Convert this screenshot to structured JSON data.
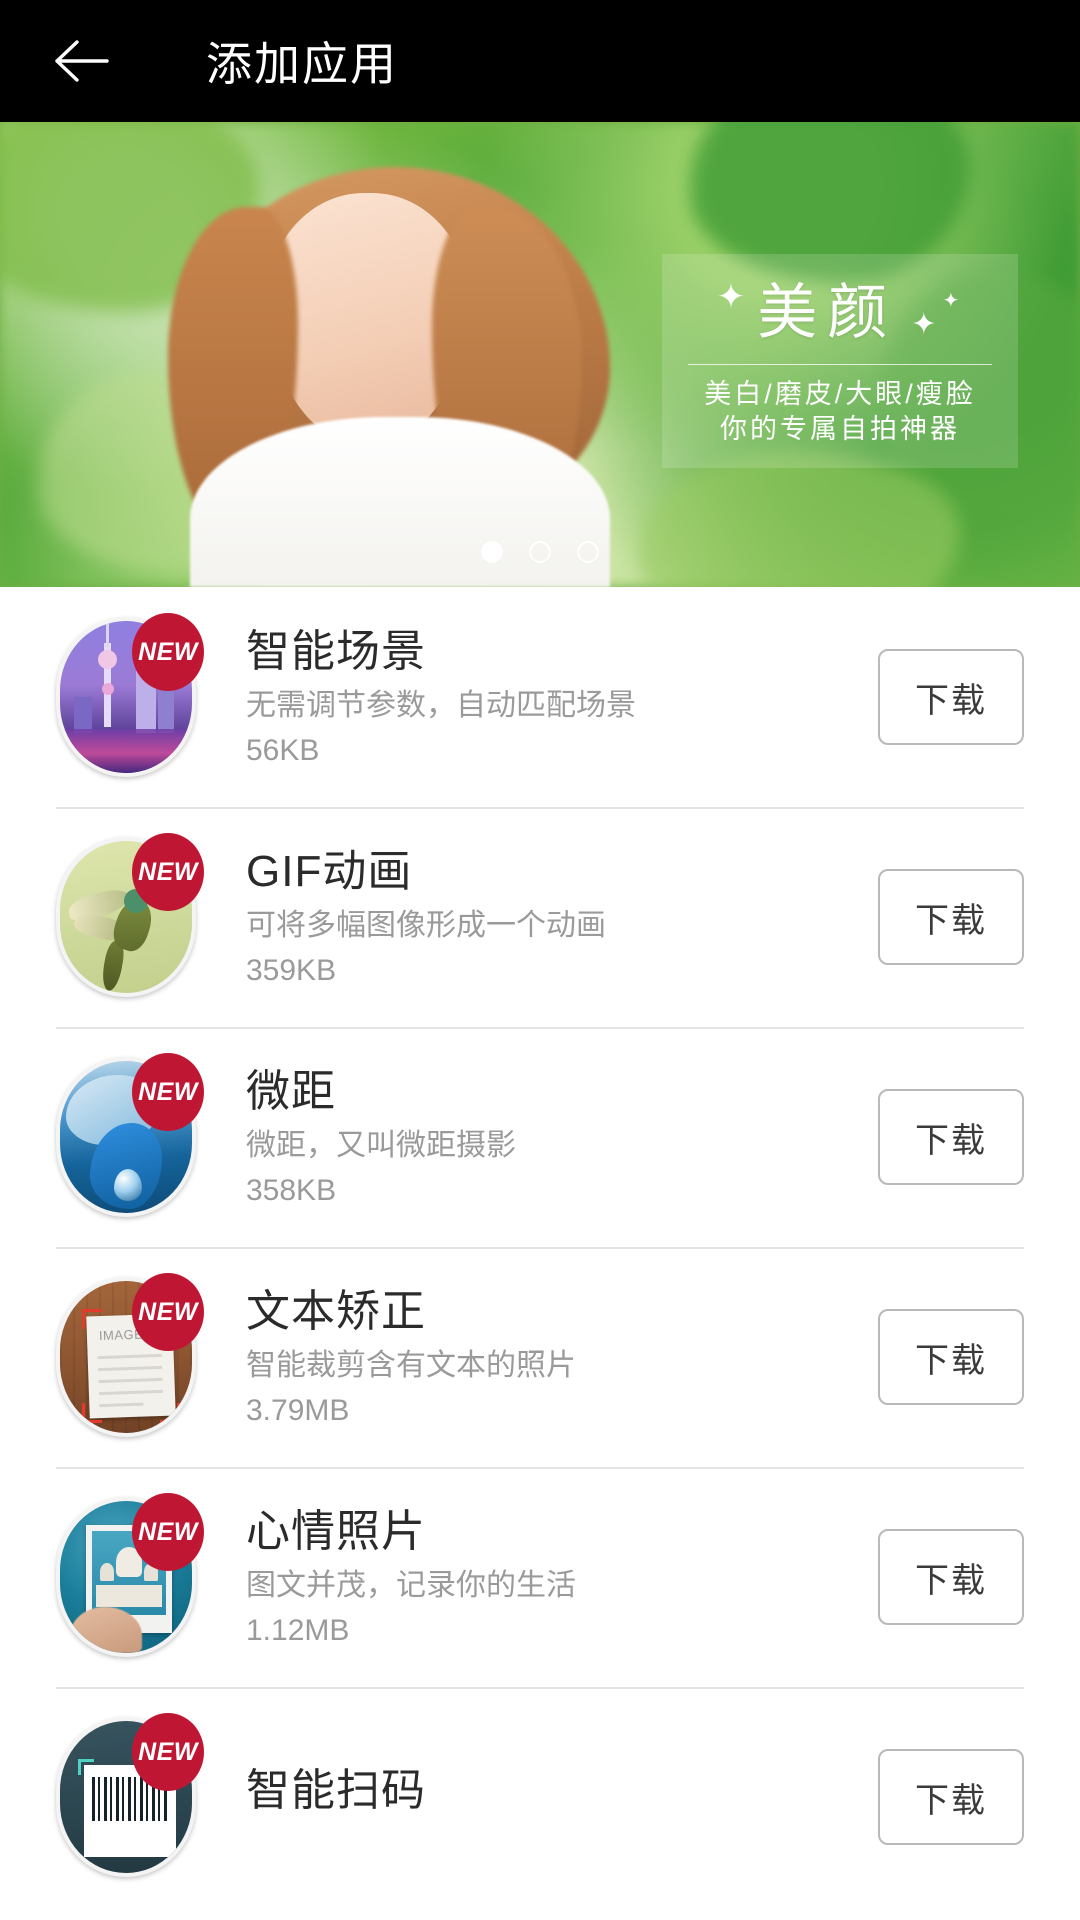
{
  "header": {
    "back_icon": "back-arrow-icon",
    "title": "添加应用"
  },
  "banner": {
    "title": "美颜",
    "subtitle_line1": "美白/磨皮/大眼/瘦脸",
    "subtitle_line2": "你的专属自拍神器",
    "sparkle_glyph": "✦",
    "dots": [
      {
        "active": true
      },
      {
        "active": false
      },
      {
        "active": false
      }
    ]
  },
  "list": {
    "badge_label": "NEW",
    "badge_color": "#bf1733",
    "download_label": "下载",
    "items": [
      {
        "name": "智能场景",
        "desc": "无需调节参数，自动匹配场景",
        "size": "56KB",
        "icon": "smart-scene-icon",
        "badge": "NEW",
        "button": "下载"
      },
      {
        "name": "GIF动画",
        "desc": "可将多幅图像形成一个动画",
        "size": "359KB",
        "icon": "gif-animation-icon",
        "badge": "NEW",
        "button": "下载"
      },
      {
        "name": "微距",
        "desc": "微距，又叫微距摄影",
        "size": "358KB",
        "icon": "macro-icon",
        "badge": "NEW",
        "button": "下载"
      },
      {
        "name": "文本矫正",
        "desc": "智能裁剪含有文本的照片",
        "size": "3.79MB",
        "icon": "text-correction-icon",
        "icon_label": "IMAGE+",
        "badge": "NEW",
        "button": "下载"
      },
      {
        "name": "心情照片",
        "desc": "图文并茂，记录你的生活",
        "size": "1.12MB",
        "icon": "mood-photo-icon",
        "badge": "NEW",
        "button": "下载"
      },
      {
        "name": "智能扫码",
        "desc": "",
        "size": "",
        "icon": "smart-scan-icon",
        "badge": "NEW",
        "button": "下载"
      }
    ]
  }
}
